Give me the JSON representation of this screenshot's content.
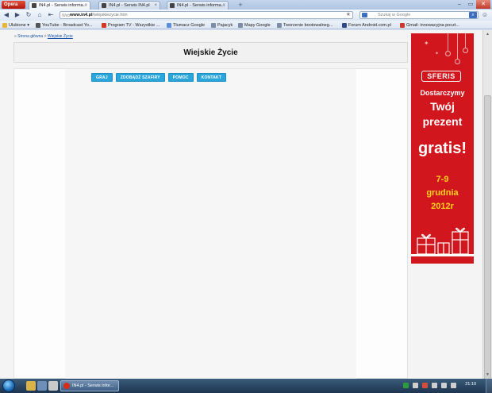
{
  "browser": {
    "opera_menu_label": "Opera",
    "tabs": [
      {
        "title": "IN4.pl - Serwis informa...",
        "active": true
      },
      {
        "title": "IN4.pl - Serwis IN4.pl",
        "active": false
      },
      {
        "title": "IN4.pl - Serwis informa...",
        "active": false
      }
    ],
    "address": {
      "web_badge": "Web",
      "domain": "www.in4.pl",
      "path": "/wiejskiezycie.htm"
    },
    "search_placeholder": "Szukaj w Google",
    "bookmarks": [
      "Ulubione",
      "YouTube - Broadcast Yo...",
      "Program TV - Wszystkie ...",
      "Tłumacz Google",
      "Pajacyk",
      "Mapy Google",
      "Tworzenie bootowalneg...",
      "Forum Android.com.pl",
      "Gmail: innowacyjna poczt..."
    ]
  },
  "page": {
    "breadcrumb": {
      "home": "Strona główna",
      "separator": ">",
      "current": "Wiejskie Życie"
    },
    "title": "Wiejskie Życie",
    "menu": [
      "GRAJ",
      "ZDOBĄDŹ SZAFIRY",
      "POMOC",
      "KONTAKT"
    ]
  },
  "ad": {
    "logo": "SFERIS",
    "line1": "Dostarczymy",
    "line2": "Twój",
    "line3": "prezent",
    "line4": "gratis!",
    "line5": "7-9",
    "line6": "grudnia",
    "line7": "2012r",
    "colors": {
      "background": "#d1161d",
      "accent": "#ffd21a"
    }
  },
  "taskbar": {
    "task_label": "IN4.pl - Serwis infor...",
    "clock": "21:10"
  }
}
